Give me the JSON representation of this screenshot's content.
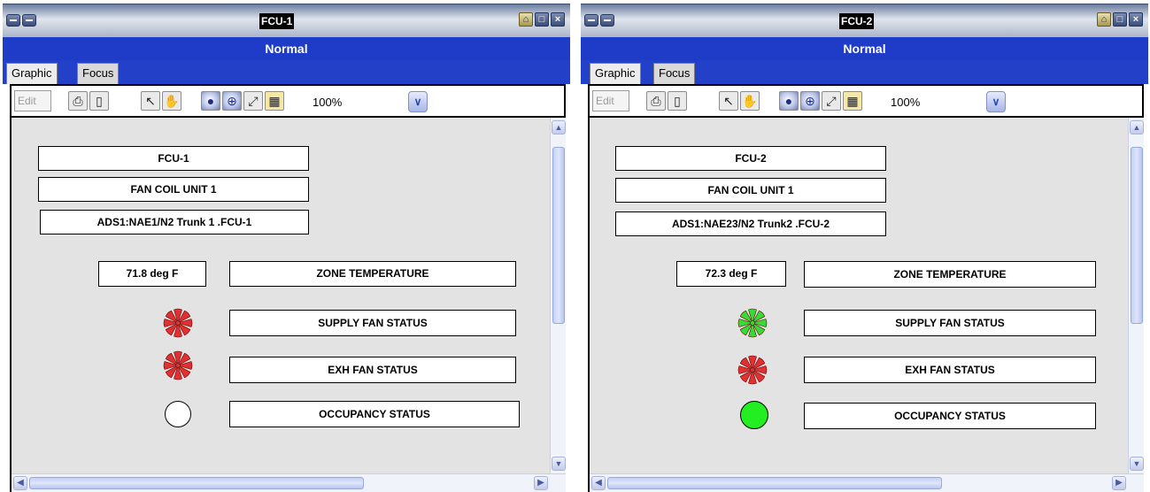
{
  "windows": [
    {
      "title": "FCU-1",
      "mode": "Normal",
      "tabs": [
        "Graphic",
        "Focus"
      ],
      "toolbar": {
        "edit_label": "Edit",
        "zoom_value": "100%"
      },
      "labels": {
        "name": "FCU-1",
        "description": "FAN COIL UNIT 1",
        "path": "ADS1:NAE1/N2 Trunk 1 .FCU-1"
      },
      "zone_temperature": {
        "value": "71.8 deg F",
        "label": "ZONE TEMPERATURE"
      },
      "supply_fan": {
        "label": "SUPPLY FAN STATUS",
        "color": "#e03030"
      },
      "exh_fan": {
        "label": "EXH FAN STATUS",
        "color": "#e03030"
      },
      "occupancy": {
        "label": "OCCUPANCY STATUS",
        "color": "#ffffff"
      }
    },
    {
      "title": "FCU-2",
      "mode": "Normal",
      "tabs": [
        "Graphic",
        "Focus"
      ],
      "toolbar": {
        "edit_label": "Edit",
        "zoom_value": "100%"
      },
      "labels": {
        "name": "FCU-2",
        "description": "FAN COIL UNIT 1",
        "path": "ADS1:NAE23/N2 Trunk2 .FCU-2"
      },
      "zone_temperature": {
        "value": "72.3 deg F",
        "label": "ZONE TEMPERATURE"
      },
      "supply_fan": {
        "label": "SUPPLY FAN STATUS",
        "color": "#33dd33"
      },
      "exh_fan": {
        "label": "EXH FAN STATUS",
        "color": "#e03030"
      },
      "occupancy": {
        "label": "OCCUPANCY STATUS",
        "color": "#22ee22"
      }
    }
  ],
  "icons": {
    "print": "printer-icon",
    "preview": "print-preview-icon",
    "select": "arrow-pointer-icon",
    "pan": "hand-icon",
    "zoom_in": "zoom-in-icon",
    "zoom_out": "zoom-out-icon",
    "zoom_fit": "zoom-fit-icon",
    "zoom_select": "zoom-select-icon"
  }
}
